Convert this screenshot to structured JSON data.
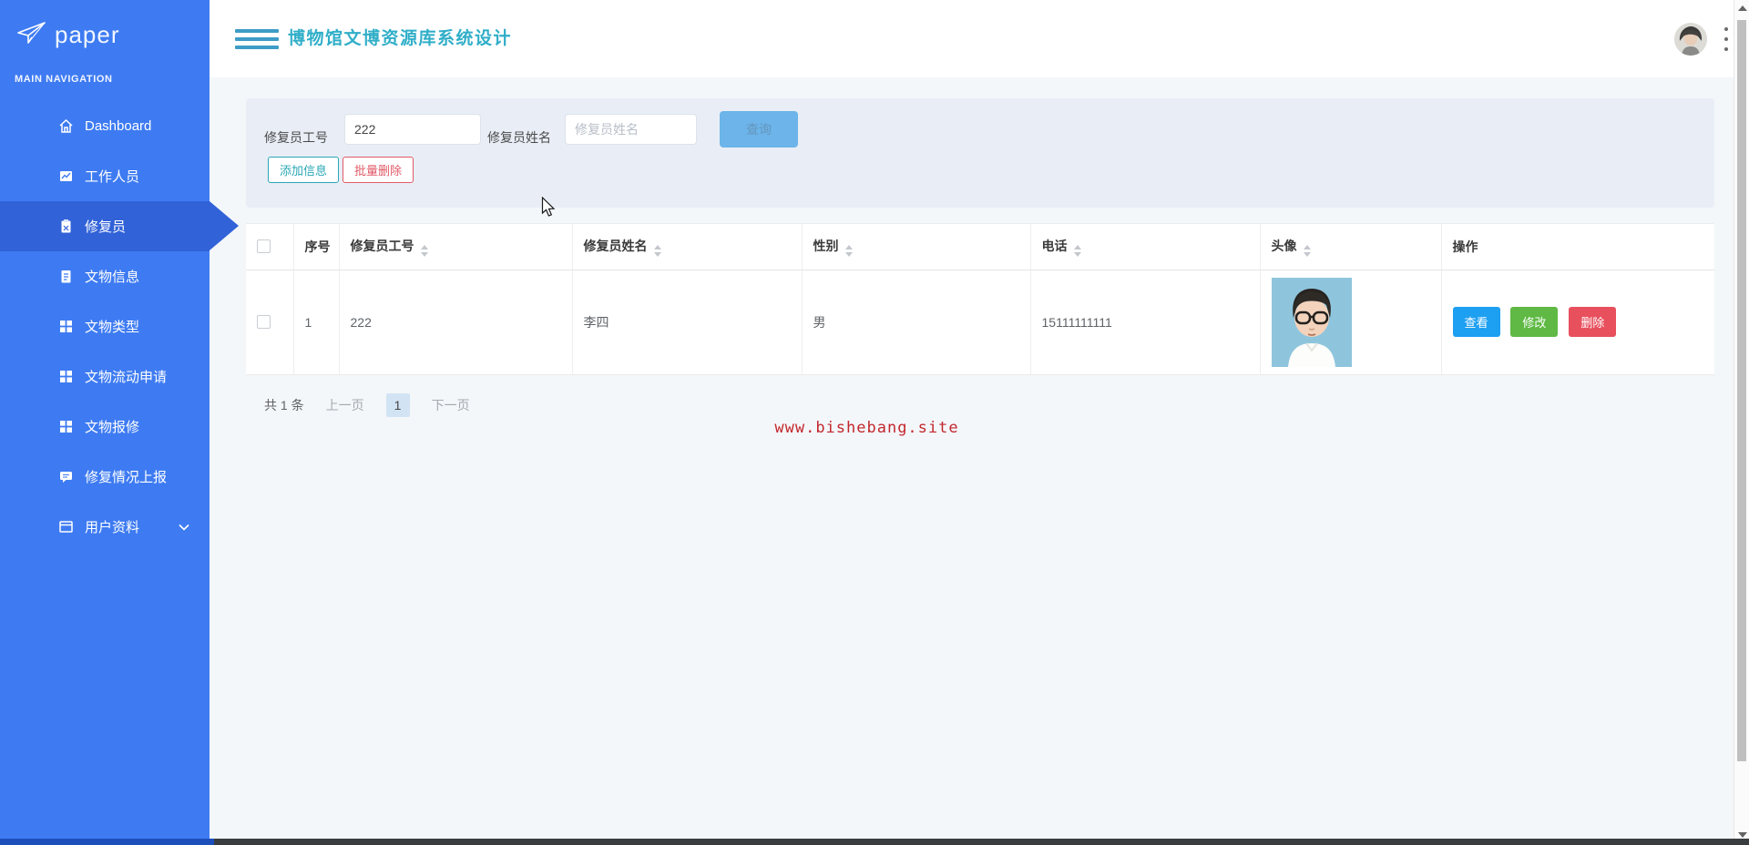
{
  "app": {
    "logo_text": "paper",
    "nav_section_label": "MAIN NAVIGATION",
    "title": "博物馆文博资源库系统设计"
  },
  "sidebar": {
    "items": [
      {
        "label": "Dashboard",
        "icon": "home-icon",
        "active": false
      },
      {
        "label": "工作人员",
        "icon": "image-icon",
        "active": false
      },
      {
        "label": "修复员",
        "icon": "clipboard-icon",
        "active": true
      },
      {
        "label": "文物信息",
        "icon": "document-icon",
        "active": false
      },
      {
        "label": "文物类型",
        "icon": "grid-icon",
        "active": false
      },
      {
        "label": "文物流动申请",
        "icon": "grid-icon",
        "active": false
      },
      {
        "label": "文物报修",
        "icon": "grid-icon",
        "active": false
      },
      {
        "label": "修复情况上报",
        "icon": "comment-icon",
        "active": false
      },
      {
        "label": "用户资料",
        "icon": "window-icon",
        "active": false,
        "has_chevron": true
      }
    ]
  },
  "filters": {
    "worker_id_label": "修复员工号",
    "worker_id_value": "222",
    "worker_name_label": "修复员姓名",
    "worker_name_placeholder": "修复员姓名",
    "search_label": "查询",
    "add_label": "添加信息",
    "batch_delete_label": "批量删除"
  },
  "table": {
    "headers": [
      {
        "label": "序号",
        "sortable": false
      },
      {
        "label": "修复员工号",
        "sortable": true
      },
      {
        "label": "修复员姓名",
        "sortable": true
      },
      {
        "label": "性别",
        "sortable": true
      },
      {
        "label": "电话",
        "sortable": true
      },
      {
        "label": "头像",
        "sortable": true
      },
      {
        "label": "操作",
        "sortable": false
      }
    ],
    "rows": [
      {
        "index": "1",
        "worker_id": "222",
        "name": "李四",
        "gender": "男",
        "phone": "15111111111",
        "avatar": "cartoon-man-with-glasses",
        "actions": {
          "view": "查看",
          "edit": "修改",
          "delete": "删除"
        }
      }
    ]
  },
  "pagination": {
    "total_text": "共 1 条",
    "prev_label": "上一页",
    "current_page": "1",
    "next_label": "下一页"
  },
  "watermark": "www.bishebang.site",
  "colors": {
    "sidebar_bg": "#3e7bf2",
    "sidebar_active_bg": "#3162d8",
    "title_teal": "#30aec8",
    "search_btn_blue": "#6cb4e9",
    "add_btn_teal": "#2aa7b5",
    "batch_btn_red": "#e15a68",
    "view_btn": "#1d9ff2",
    "edit_btn": "#5fb944",
    "delete_btn": "#e8505e",
    "watermark_red": "#c3272d"
  }
}
